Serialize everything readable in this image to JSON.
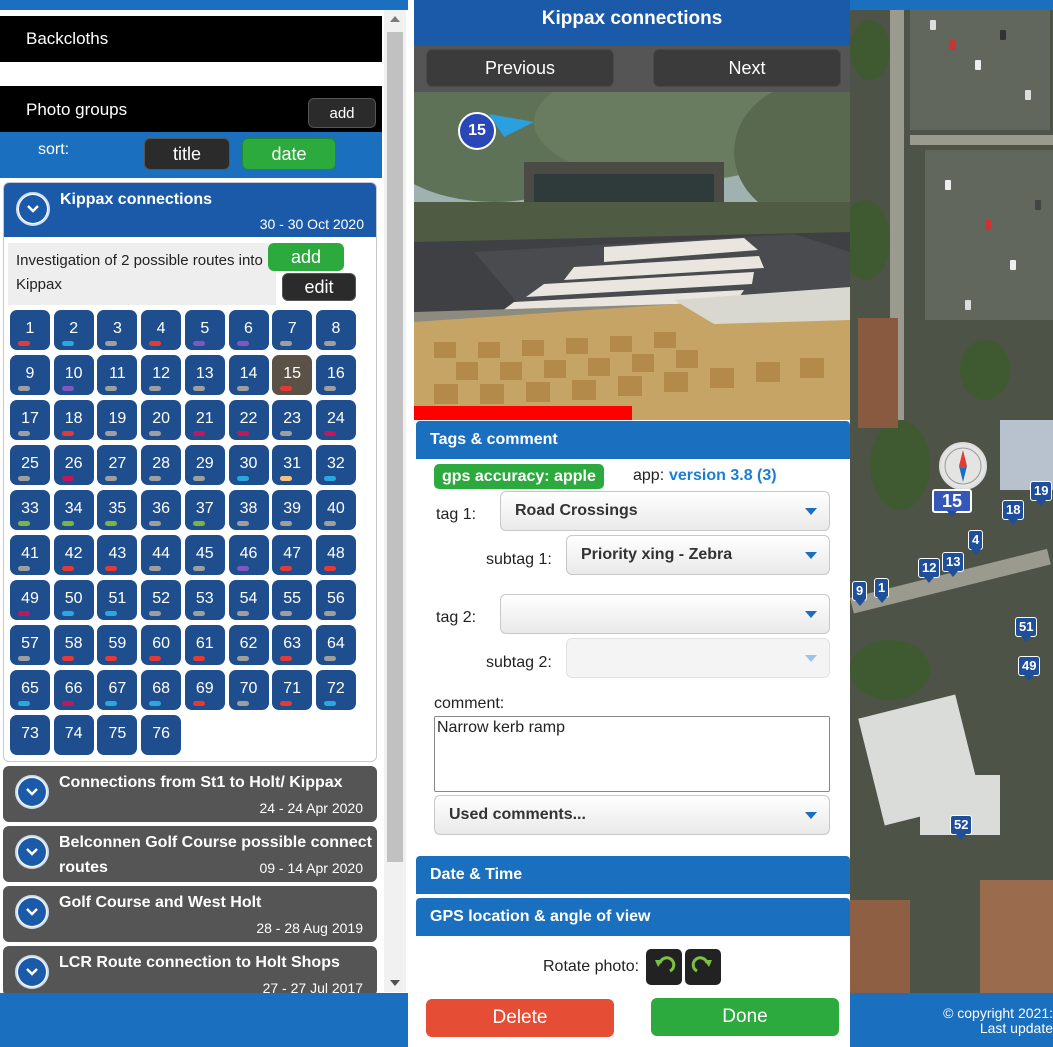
{
  "left": {
    "backcloths_label": "Backcloths",
    "photo_groups_label": "Photo groups",
    "add_group_label": "add",
    "sort_label": "sort:",
    "sort_title_label": "title",
    "sort_date_label": "date",
    "active_group": {
      "title": "Kippax connections",
      "date": "30 - 30 Oct 2020",
      "description": "Investigation of 2 possible routes into Kippax",
      "add_label": "add",
      "edit_label": "edit",
      "selected_photo": "15",
      "photos": [
        {
          "n": "1",
          "c": "#e53935"
        },
        {
          "n": "2",
          "c": "#29a8e0"
        },
        {
          "n": "3",
          "c": "#9e9e9e"
        },
        {
          "n": "4",
          "c": "#e53935"
        },
        {
          "n": "5",
          "c": "#7e57c2"
        },
        {
          "n": "6",
          "c": "#7e57c2"
        },
        {
          "n": "7",
          "c": "#9e9e9e"
        },
        {
          "n": "8",
          "c": "#9e9e9e"
        },
        {
          "n": "9",
          "c": "#9e9e9e"
        },
        {
          "n": "10",
          "c": "#7e57c2"
        },
        {
          "n": "11",
          "c": "#9e9e9e"
        },
        {
          "n": "12",
          "c": "#9e9e9e"
        },
        {
          "n": "13",
          "c": "#9e9e9e"
        },
        {
          "n": "14",
          "c": "#9e9e9e"
        },
        {
          "n": "15",
          "c": "#e53935"
        },
        {
          "n": "16",
          "c": "#9e9e9e"
        },
        {
          "n": "17",
          "c": "#9e9e9e"
        },
        {
          "n": "18",
          "c": "#e53935"
        },
        {
          "n": "19",
          "c": "#9e9e9e"
        },
        {
          "n": "20",
          "c": "#9e9e9e"
        },
        {
          "n": "21",
          "c": "#c2185b"
        },
        {
          "n": "22",
          "c": "#c2185b"
        },
        {
          "n": "23",
          "c": "#9e9e9e"
        },
        {
          "n": "24",
          "c": "#c2185b"
        },
        {
          "n": "25",
          "c": "#9e9e9e"
        },
        {
          "n": "26",
          "c": "#c2185b"
        },
        {
          "n": "27",
          "c": "#9e9e9e"
        },
        {
          "n": "28",
          "c": "#9e9e9e"
        },
        {
          "n": "29",
          "c": "#9e9e9e"
        },
        {
          "n": "30",
          "c": "#29a8e0"
        },
        {
          "n": "31",
          "c": "#f5c27a"
        },
        {
          "n": "32",
          "c": "#29a8e0"
        },
        {
          "n": "33",
          "c": "#7cb342"
        },
        {
          "n": "34",
          "c": "#7cb342"
        },
        {
          "n": "35",
          "c": "#7cb342"
        },
        {
          "n": "36",
          "c": "#9e9e9e"
        },
        {
          "n": "37",
          "c": "#7cb342"
        },
        {
          "n": "38",
          "c": "#9e9e9e"
        },
        {
          "n": "39",
          "c": "#9e9e9e"
        },
        {
          "n": "40",
          "c": "#9e9e9e"
        },
        {
          "n": "41",
          "c": "#9e9e9e"
        },
        {
          "n": "42",
          "c": "#e53935"
        },
        {
          "n": "43",
          "c": "#e53935"
        },
        {
          "n": "44",
          "c": "#9e9e9e"
        },
        {
          "n": "45",
          "c": "#9e9e9e"
        },
        {
          "n": "46",
          "c": "#7e57c2"
        },
        {
          "n": "47",
          "c": "#e53935"
        },
        {
          "n": "48",
          "c": "#e53935"
        },
        {
          "n": "49",
          "c": "#c2185b"
        },
        {
          "n": "50",
          "c": "#29a8e0"
        },
        {
          "n": "51",
          "c": "#29a8e0"
        },
        {
          "n": "52",
          "c": "#9e9e9e"
        },
        {
          "n": "53",
          "c": "#9e9e9e"
        },
        {
          "n": "54",
          "c": "#9e9e9e"
        },
        {
          "n": "55",
          "c": "#9e9e9e"
        },
        {
          "n": "56",
          "c": "#9e9e9e"
        },
        {
          "n": "57",
          "c": "#9e9e9e"
        },
        {
          "n": "58",
          "c": "#e53935"
        },
        {
          "n": "59",
          "c": "#e53935"
        },
        {
          "n": "60",
          "c": "#e53935"
        },
        {
          "n": "61",
          "c": "#e53935"
        },
        {
          "n": "62",
          "c": "#9e9e9e"
        },
        {
          "n": "63",
          "c": "#e53935"
        },
        {
          "n": "64",
          "c": "#9e9e9e"
        },
        {
          "n": "65",
          "c": "#29a8e0"
        },
        {
          "n": "66",
          "c": "#c2185b"
        },
        {
          "n": "67",
          "c": "#29a8e0"
        },
        {
          "n": "68",
          "c": "#29a8e0"
        },
        {
          "n": "69",
          "c": "#e53935"
        },
        {
          "n": "70",
          "c": "#9e9e9e"
        },
        {
          "n": "71",
          "c": "#e53935"
        },
        {
          "n": "72",
          "c": "#29a8e0"
        },
        {
          "n": "73",
          "c": ""
        },
        {
          "n": "74",
          "c": ""
        },
        {
          "n": "75",
          "c": ""
        },
        {
          "n": "76",
          "c": ""
        }
      ]
    },
    "groups": [
      {
        "title": "Connections from St1 to Holt/ Kippax",
        "date": "24 - 24 Apr 2020"
      },
      {
        "title": "Belconnen Golf Course possible connect",
        "title2": "routes",
        "date": "09 - 14 Apr 2020"
      },
      {
        "title": "Golf Course and West Holt",
        "date": "28 - 28 Aug 2019"
      },
      {
        "title": "LCR Route connection to Holt Shops",
        "date": "27 - 27 Jul 2017"
      }
    ]
  },
  "center": {
    "title": "Kippax connections",
    "previous_label": "Previous",
    "next_label": "Next",
    "photo_marker": "15",
    "tags_section": "Tags & comment",
    "gps_accuracy": "gps accuracy: apple",
    "app_label": "app:",
    "app_version": "version 3.8 (3)",
    "tag1_label": "tag 1:",
    "tag1_value": "Road Crossings",
    "subtag1_label": "subtag 1:",
    "subtag1_value": "Priority xing - Zebra",
    "tag2_label": "tag 2:",
    "tag2_value": "",
    "subtag2_label": "subtag 2:",
    "subtag2_value": "",
    "comment_label": "comment:",
    "comment_value": "Narrow kerb ramp",
    "used_comments_label": "Used comments...",
    "date_time_section": "Date & Time",
    "gps_section": "GPS location & angle of view",
    "rotate_label": "Rotate photo:",
    "delete_label": "Delete",
    "done_label": "Done"
  },
  "map": {
    "markers": [
      "15",
      "18",
      "12",
      "13",
      "4",
      "9",
      "1",
      "51",
      "49",
      "52",
      "19"
    ],
    "copyright": "© copyright 2021:",
    "last_update": "Last update"
  },
  "colors": {
    "primary_blue": "#1a6fbf",
    "header_blue": "#1a5aa8",
    "green": "#2daa3e",
    "red": "#e54d35",
    "link_blue": "#1a7fd4"
  }
}
